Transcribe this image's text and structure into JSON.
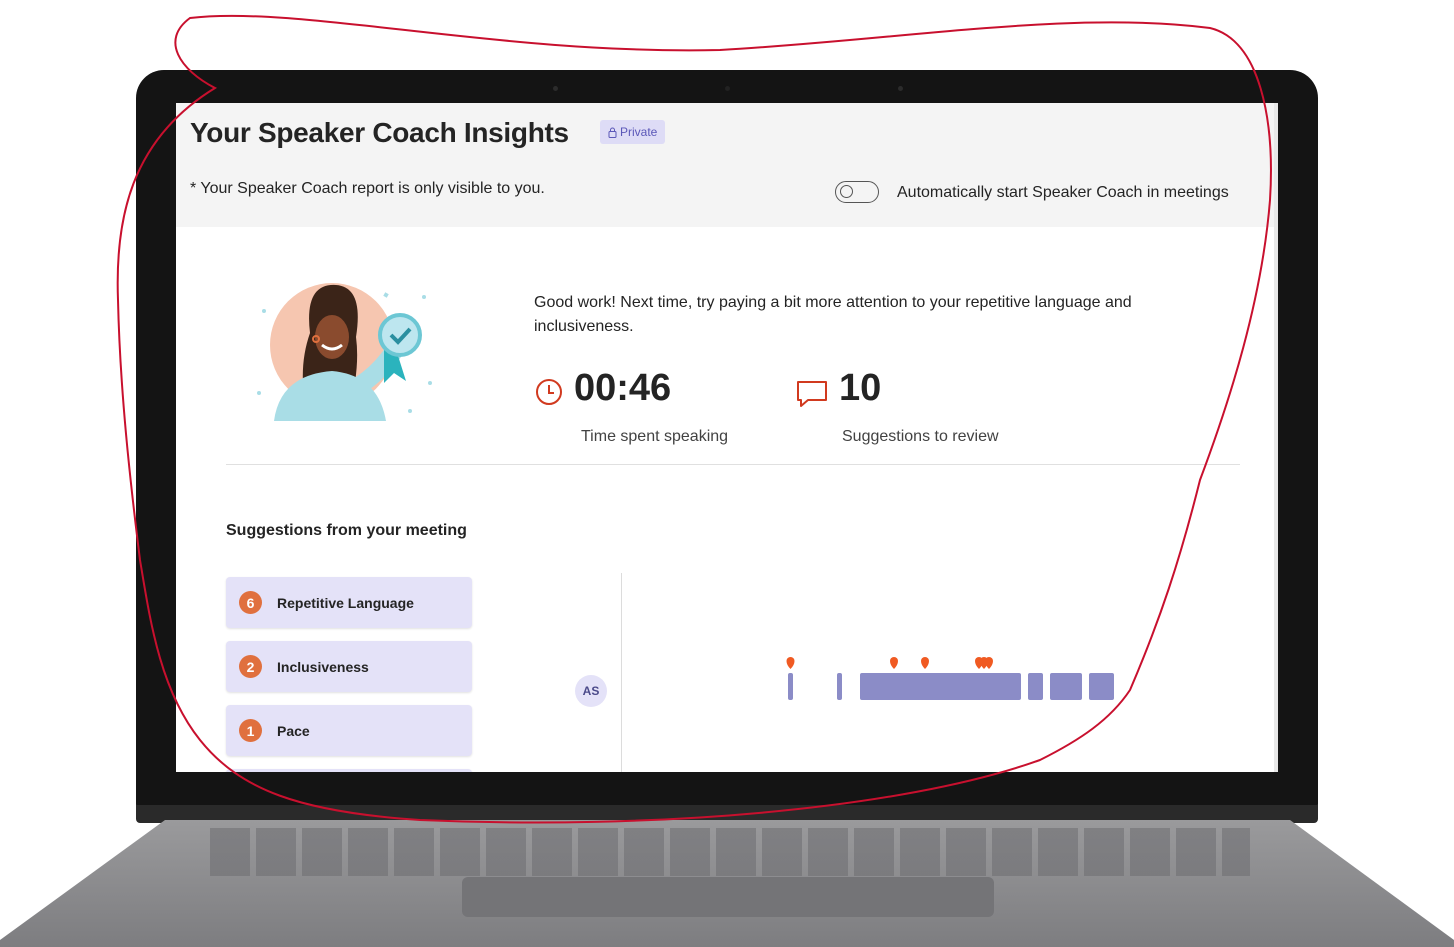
{
  "header": {
    "title": "Your Speaker Coach Insights",
    "private_badge": "Private",
    "visibility_note": "* Your Speaker Coach report is only visible to you.",
    "auto_start_label": "Automatically start Speaker Coach in meetings",
    "auto_start_enabled": false
  },
  "summary": {
    "message": "Good work! Next time, try paying a bit more attention to your repetitive language and inclusiveness.",
    "stats": [
      {
        "value": "00:46",
        "label": "Time spent speaking",
        "icon": "clock-icon"
      },
      {
        "value": "10",
        "label": "Suggestions to review",
        "icon": "comment-icon"
      }
    ]
  },
  "suggestions": {
    "title": "Suggestions from your meeting",
    "items": [
      {
        "count": "6",
        "label": "Repetitive Language"
      },
      {
        "count": "2",
        "label": "Inclusiveness"
      },
      {
        "count": "1",
        "label": "Pace"
      }
    ]
  },
  "timeline": {
    "speaker_initials": "AS"
  },
  "colors": {
    "accent": "#6264a7",
    "badge_bg": "#dedcf6",
    "count_orange": "#e0703e",
    "marker_orange": "#f05a22",
    "annotation_red": "#c8102e"
  }
}
